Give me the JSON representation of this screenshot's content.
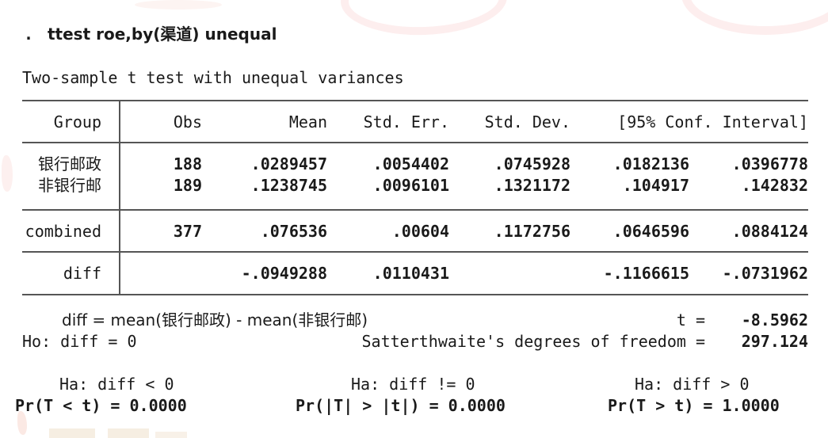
{
  "command": {
    "prompt": ".",
    "text": "ttest roe,by(渠道) unequal"
  },
  "title": "Two-sample t test with unequal variances",
  "table": {
    "columns": [
      "Group",
      "Obs",
      "Mean",
      "Std. Err.",
      "Std. Dev.",
      "[95% Conf. Interval]"
    ],
    "rows": [
      {
        "group": "银行邮政",
        "obs": "188",
        "mean": ".0289457",
        "std_err": ".0054402",
        "std_dev": ".0745928",
        "ci_low": ".0182136",
        "ci_high": ".0396778"
      },
      {
        "group": "非银行邮",
        "obs": "189",
        "mean": ".1238745",
        "std_err": ".0096101",
        "std_dev": ".1321172",
        "ci_low": ".104917",
        "ci_high": ".142832"
      },
      {
        "group": "combined",
        "obs": "377",
        "mean": ".076536",
        "std_err": ".00604",
        "std_dev": ".1172756",
        "ci_low": ".0646596",
        "ci_high": ".0884124"
      },
      {
        "group": "diff",
        "obs": "",
        "mean": "-.0949288",
        "std_err": ".0110431",
        "std_dev": "",
        "ci_low": "-.1166615",
        "ci_high": "-.0731962"
      }
    ]
  },
  "footer": {
    "diff_definition": "diff = mean(银行邮政) - mean(非银行邮)",
    "t_label": "t =",
    "t_value": "-8.5962",
    "ho": "Ho: diff = 0",
    "df_label": "Satterthwaite's degrees of freedom =",
    "df_value": "297.124"
  },
  "hypotheses": {
    "left": {
      "ha": "Ha: diff < 0",
      "pr": "Pr(T < t) = 0.0000"
    },
    "center": {
      "ha": "Ha: diff != 0",
      "pr": "Pr(|T| > |t|) = 0.0000"
    },
    "right": {
      "ha": "Ha: diff > 0",
      "pr": "Pr(T > t) = 1.0000"
    }
  },
  "colors": {
    "background": "#ffffff",
    "text": "#1a1a1a",
    "rule": "#555555",
    "watermark": "#fdeeee"
  }
}
